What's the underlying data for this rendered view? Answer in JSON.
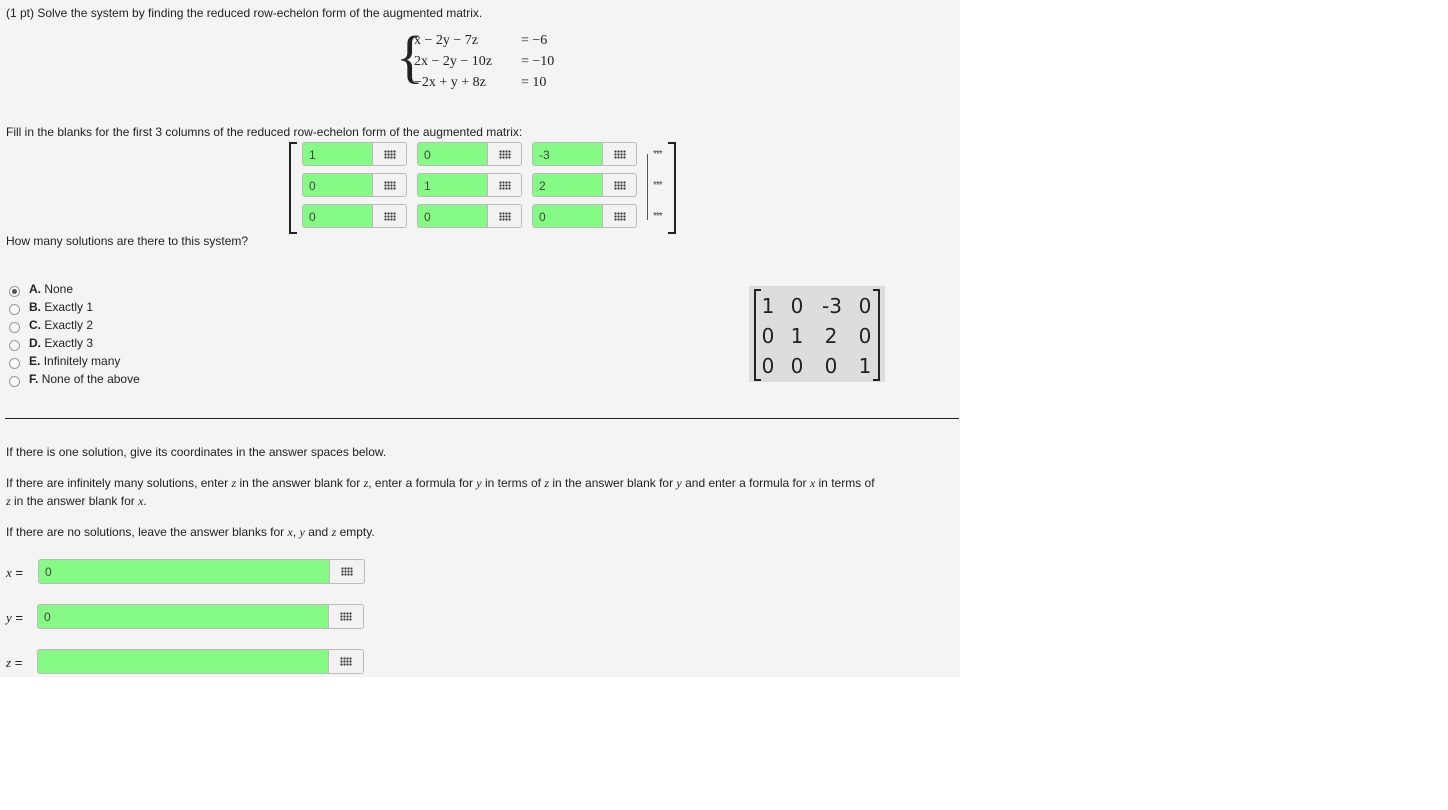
{
  "problem": {
    "header": "(1 pt) Solve the system by finding the reduced row-echelon form of the augmented matrix.",
    "equations": [
      {
        "lhs": "x − 2y − 7z",
        "rhs": "= −6"
      },
      {
        "lhs": "2x − 2y − 10z",
        "rhs": "= −10"
      },
      {
        "lhs": "−2x + y + 8z",
        "rhs": "= 10"
      }
    ],
    "fill_prompt": "Fill in the blanks for the first 3 columns of the reduced row-echelon form of the augmented matrix:",
    "matrix_rows": [
      [
        "1",
        "0",
        "-3"
      ],
      [
        "0",
        "1",
        "2"
      ],
      [
        "0",
        "0",
        "0"
      ]
    ],
    "ellipsis": "***",
    "solutions_question": "How many solutions are there to this system?"
  },
  "options": [
    {
      "letter": "A.",
      "text": "None",
      "selected": true
    },
    {
      "letter": "B.",
      "text": "Exactly 1",
      "selected": false
    },
    {
      "letter": "C.",
      "text": "Exactly 2",
      "selected": false
    },
    {
      "letter": "D.",
      "text": "Exactly 3",
      "selected": false
    },
    {
      "letter": "E.",
      "text": "Infinitely many",
      "selected": false
    },
    {
      "letter": "F.",
      "text": "None of the above",
      "selected": false
    }
  ],
  "matrix_image": {
    "rows": [
      [
        "1",
        "0",
        "-3",
        "0"
      ],
      [
        "0",
        "1",
        "2",
        "0"
      ],
      [
        "0",
        "0",
        "0",
        "1"
      ]
    ]
  },
  "instructions": {
    "one_solution": "If there is one solution, give its coordinates in the answer spaces below.",
    "inf_part1": "If there are infinitely many solutions, enter",
    "inf_z1": "z",
    "inf_part2": "in the answer blank for",
    "inf_z2": "z",
    "inf_part3": ", enter a formula for",
    "inf_y1": "y",
    "inf_part4": "in terms of",
    "inf_z3": "z",
    "inf_part5": "in the answer blank for",
    "inf_y2": "y",
    "inf_part6": "and enter a formula for",
    "inf_x1": "x",
    "inf_part7": "in terms of",
    "inf_line2_z": "z",
    "inf_line2_text": "in the answer blank for",
    "inf_line2_x": "x",
    "inf_line2_end": ".",
    "none_part1": "If there are no solutions, leave the answer blanks for",
    "none_x": "x",
    "none_sep": ",",
    "none_y": "y",
    "none_and": "and",
    "none_z": "z",
    "none_end": "empty."
  },
  "answers": [
    {
      "var": "x",
      "eq": "=",
      "value": "0"
    },
    {
      "var": "y",
      "eq": "=",
      "value": "0"
    },
    {
      "var": "z",
      "eq": "=",
      "value": ""
    }
  ]
}
